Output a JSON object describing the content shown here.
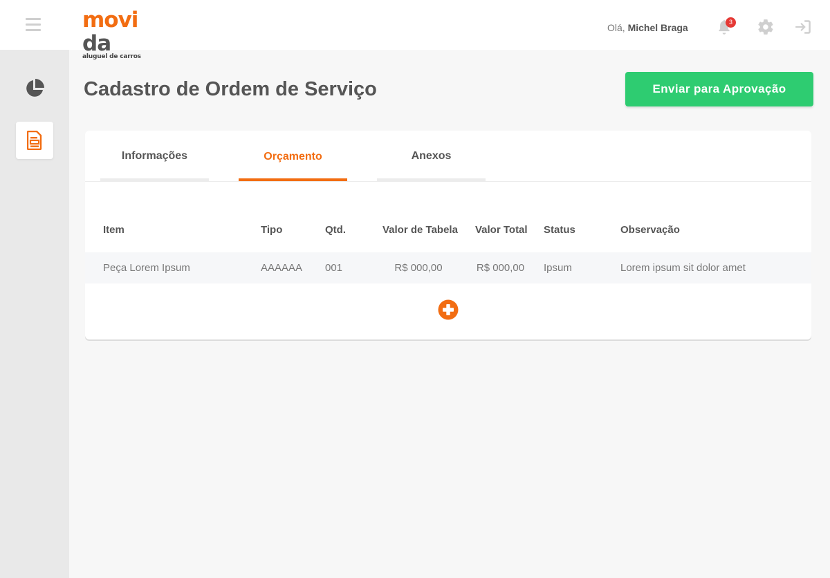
{
  "header": {
    "logo_main": "movida",
    "logo_sub": "aluguel de carros",
    "greeting_prefix": "Olá,",
    "user_name": "Michel Braga",
    "notification_count": "3"
  },
  "icons": {
    "menu": "hamburger-icon",
    "notifications": "bell-icon",
    "settings": "gear-icon",
    "logout": "sign-out-icon",
    "dashboard": "pie-chart-icon",
    "service_order": "document-icon",
    "add": "plus-circle-icon"
  },
  "colors": {
    "brand_orange": "#f26d12",
    "success_green": "#2ecc71",
    "badge_red": "#e53935"
  },
  "page": {
    "title": "Cadastro de Ordem de Serviço",
    "primary_action": "Enviar para Aprovação"
  },
  "tabs": [
    {
      "label": "Informações",
      "active": false
    },
    {
      "label": "Orçamento",
      "active": true
    },
    {
      "label": "Anexos",
      "active": false
    }
  ],
  "table": {
    "columns": [
      "Item",
      "Tipo",
      "Qtd.",
      "Valor de Tabela",
      "Valor Total",
      "Status",
      "Observação"
    ],
    "rows": [
      [
        "Peça Lorem Ipsum",
        "AAAAAA",
        "001",
        "R$ 000,00",
        "R$ 000,00",
        "Ipsum",
        "Lorem ipsum sit dolor amet"
      ]
    ]
  }
}
